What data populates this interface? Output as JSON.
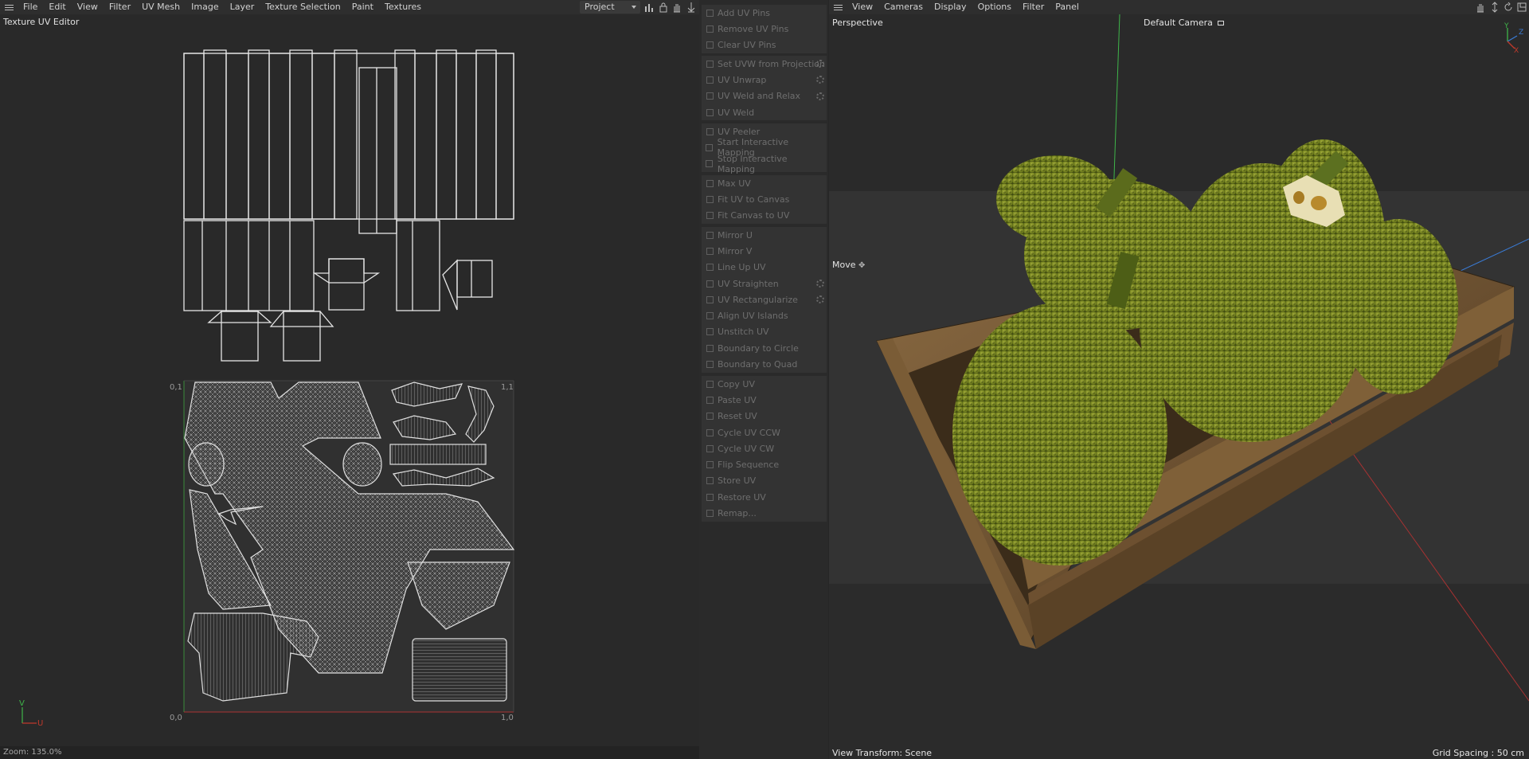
{
  "uv_editor": {
    "menu": [
      "File",
      "Edit",
      "View",
      "Filter",
      "UV Mesh",
      "Image",
      "Layer",
      "Texture Selection",
      "Paint",
      "Textures"
    ],
    "project_select": "Project",
    "title": "Texture UV Editor",
    "coords": {
      "top_left": "0,1",
      "top_right": "1,1",
      "bottom_left": "0,0",
      "bottom_right": "1,0"
    },
    "axis_v": "V",
    "axis_u": "U",
    "status": "Zoom: 135.0%"
  },
  "uv_tools": {
    "groups": [
      [
        {
          "label": "Add UV Pins",
          "icon": "pin-add-icon"
        },
        {
          "label": "Remove UV Pins",
          "icon": "pin-remove-icon"
        },
        {
          "label": "Clear UV Pins",
          "icon": "pin-clear-icon"
        }
      ],
      [
        {
          "label": "Set UVW from Projection",
          "icon": "projection-icon",
          "gear": true
        },
        {
          "label": "UV Unwrap",
          "icon": "unwrap-icon",
          "gear": true
        },
        {
          "label": "UV Weld and Relax",
          "icon": "weld-relax-icon",
          "gear": true
        },
        {
          "label": "UV Weld",
          "icon": "weld-icon"
        }
      ],
      [
        {
          "label": "UV Peeler",
          "icon": "peeler-icon"
        },
        {
          "label": "Start Interactive Mapping",
          "icon": "play-icon"
        },
        {
          "label": "Stop Interactive Mapping",
          "icon": "stop-icon"
        }
      ],
      [
        {
          "label": "Max UV",
          "icon": "max-uv-icon"
        },
        {
          "label": "Fit UV to Canvas",
          "icon": "fit-uv-icon"
        },
        {
          "label": "Fit Canvas to UV",
          "icon": "fit-canvas-icon"
        }
      ],
      [
        {
          "label": "Mirror U",
          "icon": "mirror-u-icon"
        },
        {
          "label": "Mirror V",
          "icon": "mirror-v-icon"
        },
        {
          "label": "Line Up UV",
          "icon": "line-up-icon"
        },
        {
          "label": "UV Straighten",
          "icon": "straighten-icon",
          "gear": true
        },
        {
          "label": "UV Rectangularize",
          "icon": "rectangularize-icon",
          "gear": true
        },
        {
          "label": "Align UV Islands",
          "icon": "align-islands-icon"
        },
        {
          "label": "Unstitch UV",
          "icon": "unstitch-icon"
        },
        {
          "label": "Boundary to Circle",
          "icon": "boundary-circle-icon"
        },
        {
          "label": "Boundary to Quad",
          "icon": "boundary-quad-icon"
        }
      ],
      [
        {
          "label": "Copy UV",
          "icon": "copy-icon"
        },
        {
          "label": "Paste UV",
          "icon": "paste-icon"
        },
        {
          "label": "Reset UV",
          "icon": "reset-icon"
        },
        {
          "label": "Cycle UV CCW",
          "icon": "cycle-ccw-icon"
        },
        {
          "label": "Cycle UV CW",
          "icon": "cycle-cw-icon"
        },
        {
          "label": "Flip Sequence",
          "icon": "flip-icon"
        },
        {
          "label": "Store UV",
          "icon": "store-icon"
        },
        {
          "label": "Restore UV",
          "icon": "restore-icon"
        },
        {
          "label": "Remap...",
          "icon": "remap-icon"
        }
      ]
    ]
  },
  "viewport": {
    "menu": [
      "View",
      "Cameras",
      "Display",
      "Options",
      "Filter",
      "Panel"
    ],
    "label": "Perspective",
    "camera": "Default Camera",
    "tool": "Move",
    "axes": {
      "y": "Y",
      "z": "Z",
      "x": "X"
    },
    "view_transform": "View Transform: Scene",
    "grid_spacing": "Grid Spacing : 50 cm",
    "colors": {
      "y_axis": "#3fb54a",
      "x_axis": "#c0392b",
      "z_axis": "#3a7bd5",
      "fruit": "#7c8a24",
      "crate": "#6b4e2e"
    }
  }
}
